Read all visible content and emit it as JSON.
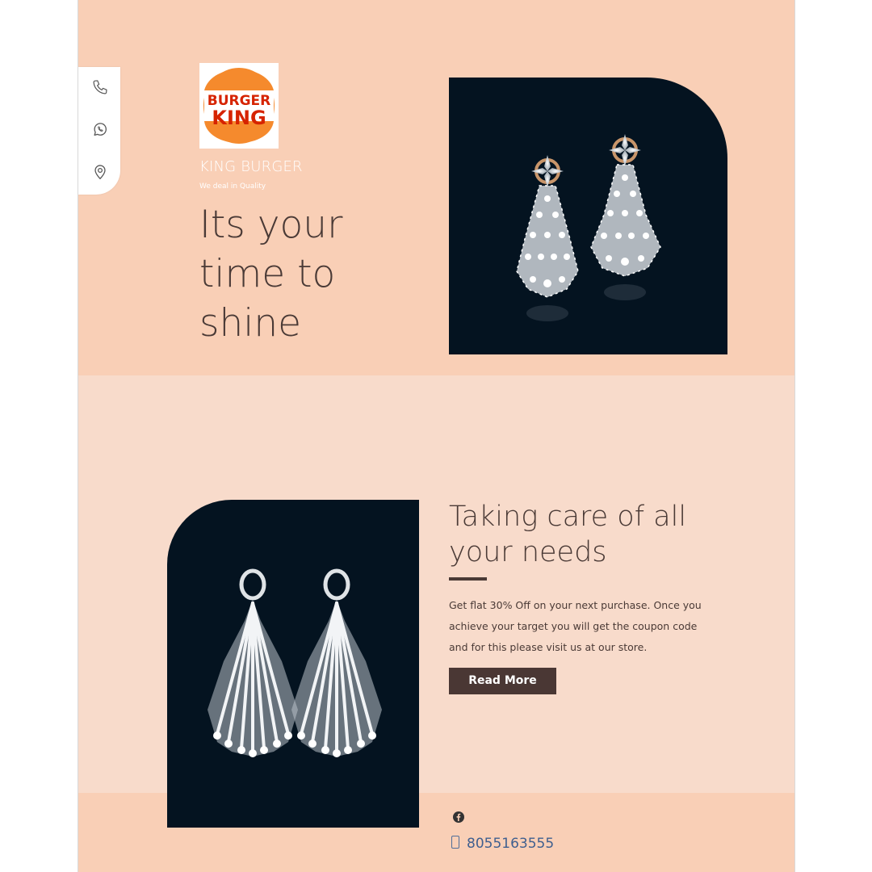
{
  "brand": {
    "logo_text_line1": "BURGER",
    "logo_text_line2": "KING",
    "name": "KING BURGER",
    "tagline": "We deal in Quality"
  },
  "contact_bar": {
    "icons": [
      "phone-icon",
      "whatsapp-icon",
      "location-pin-icon"
    ]
  },
  "hero": {
    "title_lines": [
      "Its your",
      "time to",
      "shine"
    ]
  },
  "feature": {
    "title_lines": [
      "Taking care of all",
      "your needs"
    ],
    "body_lines": [
      "Get flat 30% Off on your next purchase. Once you",
      "achieve your target you will get the coupon code",
      "and for this please visit us at our store."
    ],
    "button_label": "Read More"
  },
  "footer": {
    "social_icon": "facebook-icon",
    "phone_number": "8055163555"
  },
  "colors": {
    "page_background": "#f8dbcb",
    "hero_background": "#f9cfb6",
    "image_background": "#041320",
    "text_dark": "#4a3a36",
    "button": "#4a3734",
    "link_blue": "#3f5f8f",
    "logo_orange": "#f58a2d",
    "logo_red": "#d62300"
  }
}
